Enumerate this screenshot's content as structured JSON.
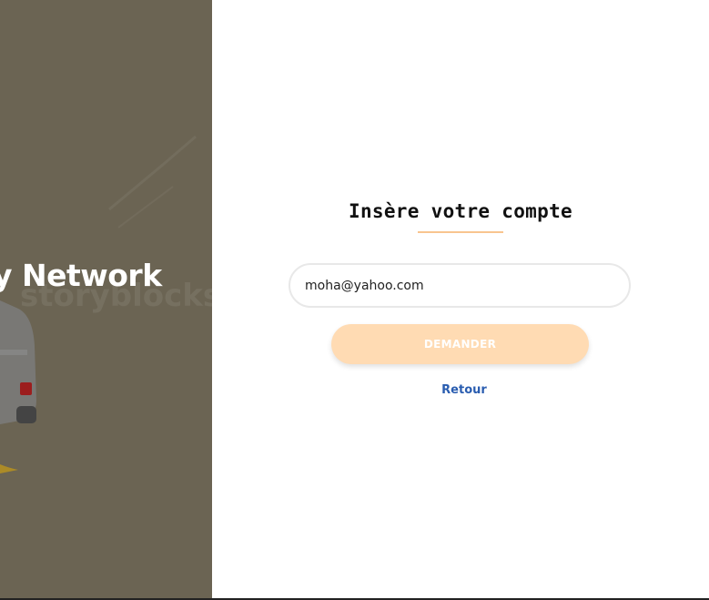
{
  "hero": {
    "title": "y Network",
    "watermark": "storyblocks"
  },
  "form": {
    "title": "Insère votre compte",
    "email_value": "moha@yahoo.com",
    "request_label": "DEMANDER",
    "back_label": "Retour"
  },
  "colors": {
    "hero_bg": "#6b6453",
    "accent_underline": "#f8c58f",
    "button_bg": "#ffdbb3",
    "link": "#2a5db0"
  }
}
